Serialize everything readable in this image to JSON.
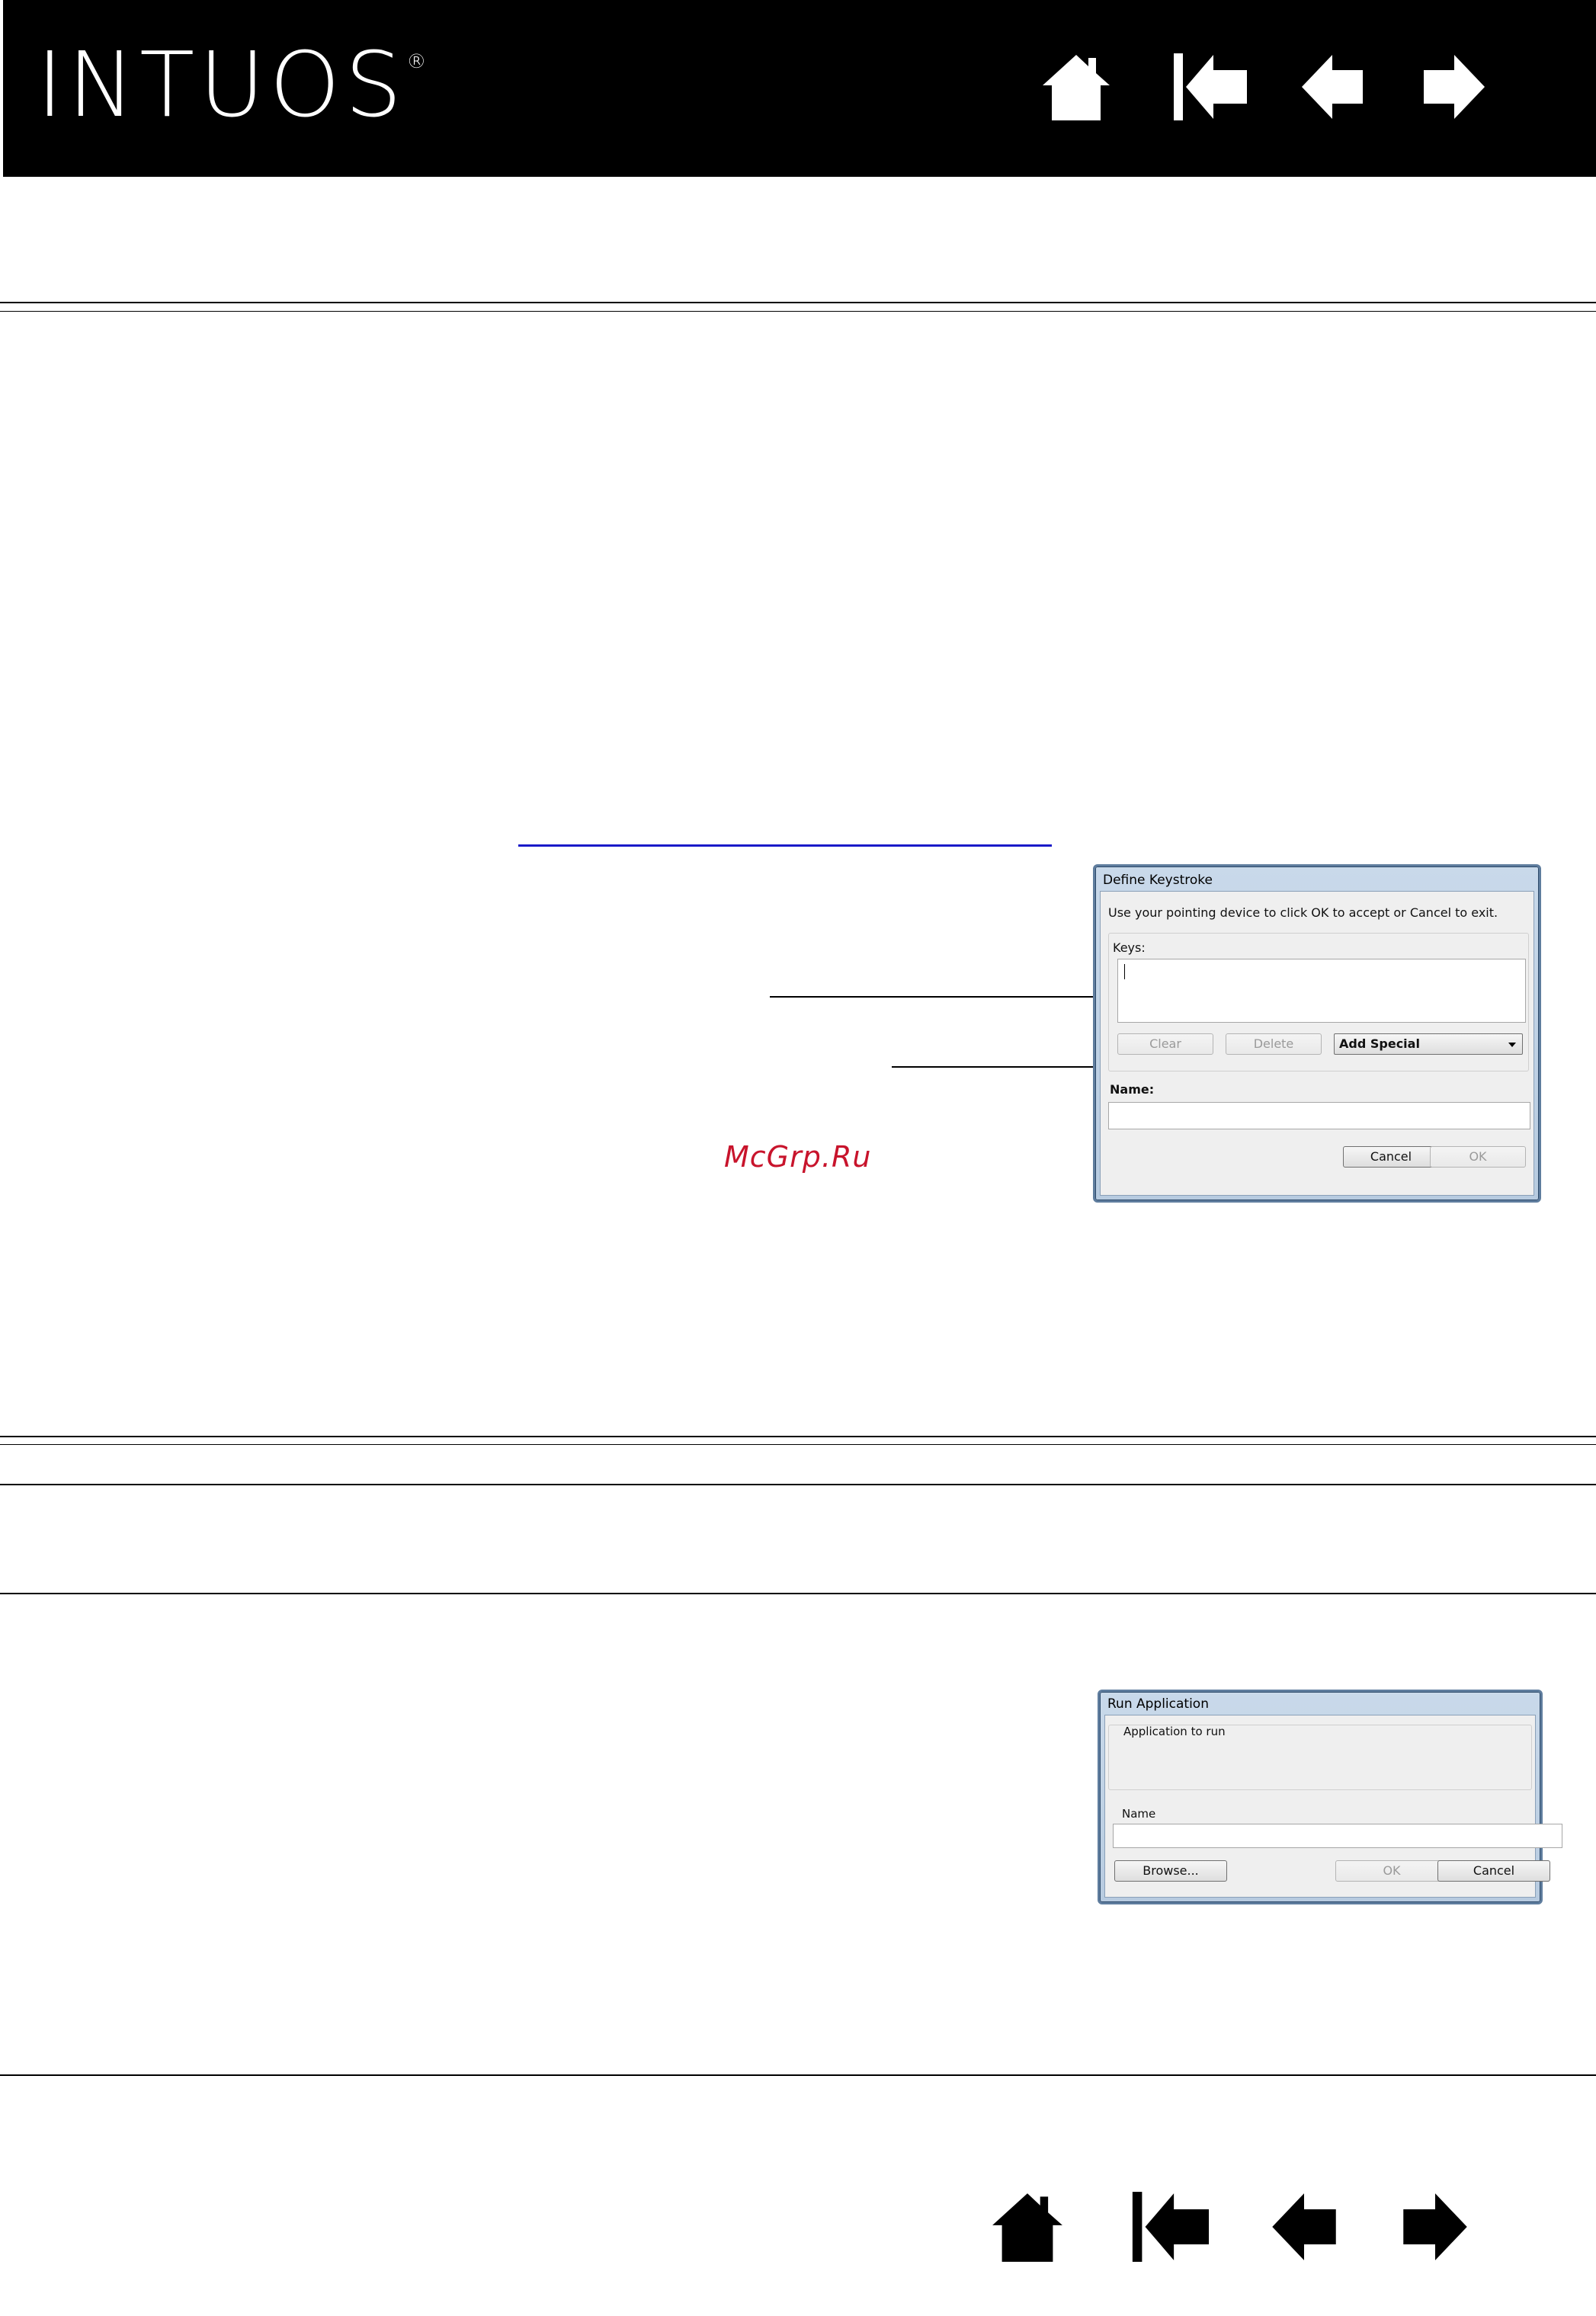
{
  "header": {
    "brand": "INTUOS",
    "brand_mark": "®",
    "nav_icons": [
      "home-icon",
      "first-page-icon",
      "previous-page-icon",
      "next-page-icon"
    ]
  },
  "watermark": "McGrp.Ru",
  "define_keystroke_dialog": {
    "title": "Define Keystroke",
    "instruction": "Use your pointing device to click OK to accept or Cancel to exit.",
    "keys_label": "Keys:",
    "keys_value": "",
    "clear_button": "Clear",
    "delete_button": "Delete",
    "add_special_select": "Add Special",
    "name_label": "Name:",
    "name_value": "",
    "cancel_button": "Cancel",
    "ok_button": "OK"
  },
  "run_application_dialog": {
    "title": "Run Application",
    "group_label": "Application to run",
    "name_label": "Name",
    "name_value": "",
    "browse_button": "Browse...",
    "ok_button": "OK",
    "cancel_button": "Cancel"
  },
  "footer": {
    "nav_icons": [
      "home-icon",
      "first-page-icon",
      "previous-page-icon",
      "next-page-icon"
    ]
  }
}
